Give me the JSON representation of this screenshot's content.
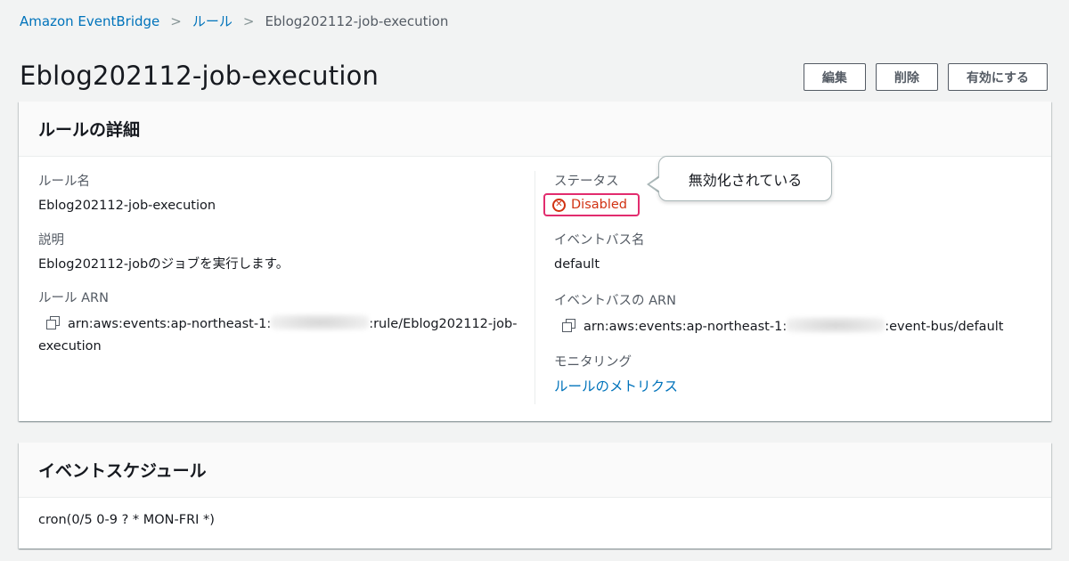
{
  "breadcrumb": {
    "root": "Amazon EventBridge",
    "rules": "ルール",
    "current": "Eblog202112-job-execution"
  },
  "title": "Eblog202112-job-execution",
  "actions": {
    "edit": "編集",
    "delete": "削除",
    "enable": "有効にする"
  },
  "details": {
    "heading": "ルールの詳細",
    "rule_name_label": "ルール名",
    "rule_name": "Eblog202112-job-execution",
    "description_label": "説明",
    "description": "Eblog202112-jobのジョブを実行します。",
    "arn_label": "ルール ARN",
    "arn_prefix": "arn:aws:events:ap-northeast-1:",
    "arn_suffix": ":rule/Eblog202112-job-",
    "arn_suffix2": "execution",
    "status_label": "ステータス",
    "status": "Disabled",
    "status_color": "#d13212",
    "event_bus_name_label": "イベントバス名",
    "event_bus_name": "default",
    "event_bus_arn_label": "イベントバスの ARN",
    "event_bus_arn_prefix": "arn:aws:events:ap-northeast-1:",
    "event_bus_arn_suffix": ":event-bus/default",
    "monitoring_label": "モニタリング",
    "monitoring_link": "ルールのメトリクス"
  },
  "callout": {
    "text": "無効化されている"
  },
  "schedule": {
    "heading": "イベントスケジュール",
    "expression": "cron(0/5 0-9 ? * MON-FRI *)"
  }
}
